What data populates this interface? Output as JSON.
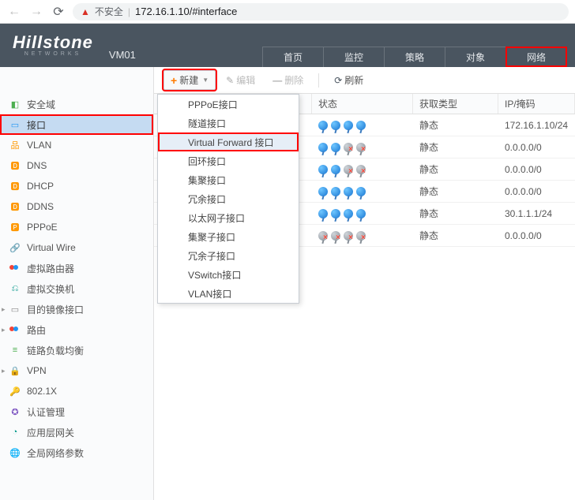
{
  "browser": {
    "insecure_label": "不安全",
    "url": "172.16.1.10/#interface"
  },
  "brand": {
    "name": "Hillstone",
    "sub": "NETWORKS"
  },
  "host": "VM01",
  "nav": [
    {
      "label": "首页"
    },
    {
      "label": "监控"
    },
    {
      "label": "策略"
    },
    {
      "label": "对象"
    },
    {
      "label": "网络",
      "highlight": true
    }
  ],
  "sidebar": [
    {
      "label": "安全域",
      "icon": "◧",
      "cls": "si-green"
    },
    {
      "label": "接口",
      "icon": "▭",
      "cls": "si-blue",
      "selected": true,
      "highlight": true
    },
    {
      "label": "VLAN",
      "icon": "品",
      "cls": "si-orange"
    },
    {
      "label": "DNS",
      "icon": "🅳",
      "cls": "si-orange"
    },
    {
      "label": "DHCP",
      "icon": "🅳",
      "cls": "si-orange"
    },
    {
      "label": "DDNS",
      "icon": "🅳",
      "cls": "si-orange"
    },
    {
      "label": "PPPoE",
      "icon": "🅿",
      "cls": "si-orange"
    },
    {
      "label": "Virtual Wire",
      "icon": "🔗",
      "cls": "si-gray"
    },
    {
      "label": "虚拟路由器",
      "icon": "",
      "cls": "si-multi"
    },
    {
      "label": "虚拟交换机",
      "icon": "⎌",
      "cls": "si-teal"
    },
    {
      "label": "目的镜像接口",
      "icon": "▭",
      "cls": "si-gray",
      "expandable": true
    },
    {
      "label": "路由",
      "icon": "",
      "cls": "si-multi",
      "expandable": true
    },
    {
      "label": "链路负载均衡",
      "icon": "≡",
      "cls": "si-green"
    },
    {
      "label": "VPN",
      "icon": "🔒",
      "cls": "si-orange",
      "expandable": true
    },
    {
      "label": "802.1X",
      "icon": "🔑",
      "cls": "si-orange"
    },
    {
      "label": "认证管理",
      "icon": "✪",
      "cls": "si-purple"
    },
    {
      "label": "应用层网关",
      "icon": "◔",
      "cls": "si-teal"
    },
    {
      "label": "全局网络参数",
      "icon": "🌐",
      "cls": "si-blue"
    }
  ],
  "toolbar": {
    "new": "新建",
    "edit": "编辑",
    "delete": "删除",
    "refresh": "刷新"
  },
  "dropdown": [
    {
      "label": "PPPoE接口"
    },
    {
      "label": "隧道接口"
    },
    {
      "label": "Virtual Forward 接口",
      "hover": true,
      "highlight": true
    },
    {
      "label": "回环接口"
    },
    {
      "label": "集聚接口"
    },
    {
      "label": "冗余接口"
    },
    {
      "label": "以太网子接口"
    },
    {
      "label": "集聚子接口"
    },
    {
      "label": "冗余子接口"
    },
    {
      "label": "VSwitch接口"
    },
    {
      "label": "VLAN接口"
    }
  ],
  "table": {
    "headers": {
      "status": "状态",
      "type": "获取类型",
      "ip": "IP/掩码"
    },
    "rows": [
      {
        "balls": [
          "blue",
          "blue",
          "blue",
          "blue"
        ],
        "type": "静态",
        "ip": "172.16.1.10/24"
      },
      {
        "balls": [
          "blue",
          "blue",
          "gray-err",
          "gray-err"
        ],
        "type": "静态",
        "ip": "0.0.0.0/0"
      },
      {
        "balls": [
          "blue",
          "blue",
          "gray-err",
          "gray-err"
        ],
        "type": "静态",
        "ip": "0.0.0.0/0"
      },
      {
        "balls": [
          "blue",
          "blue",
          "blue",
          "blue"
        ],
        "type": "静态",
        "ip": "0.0.0.0/0"
      },
      {
        "balls": [
          "blue",
          "blue",
          "blue",
          "blue"
        ],
        "type": "静态",
        "ip": "30.1.1.1/24"
      },
      {
        "balls": [
          "gray-err",
          "gray-err",
          "gray-err",
          "gray-err"
        ],
        "type": "静态",
        "ip": "0.0.0.0/0"
      }
    ]
  }
}
